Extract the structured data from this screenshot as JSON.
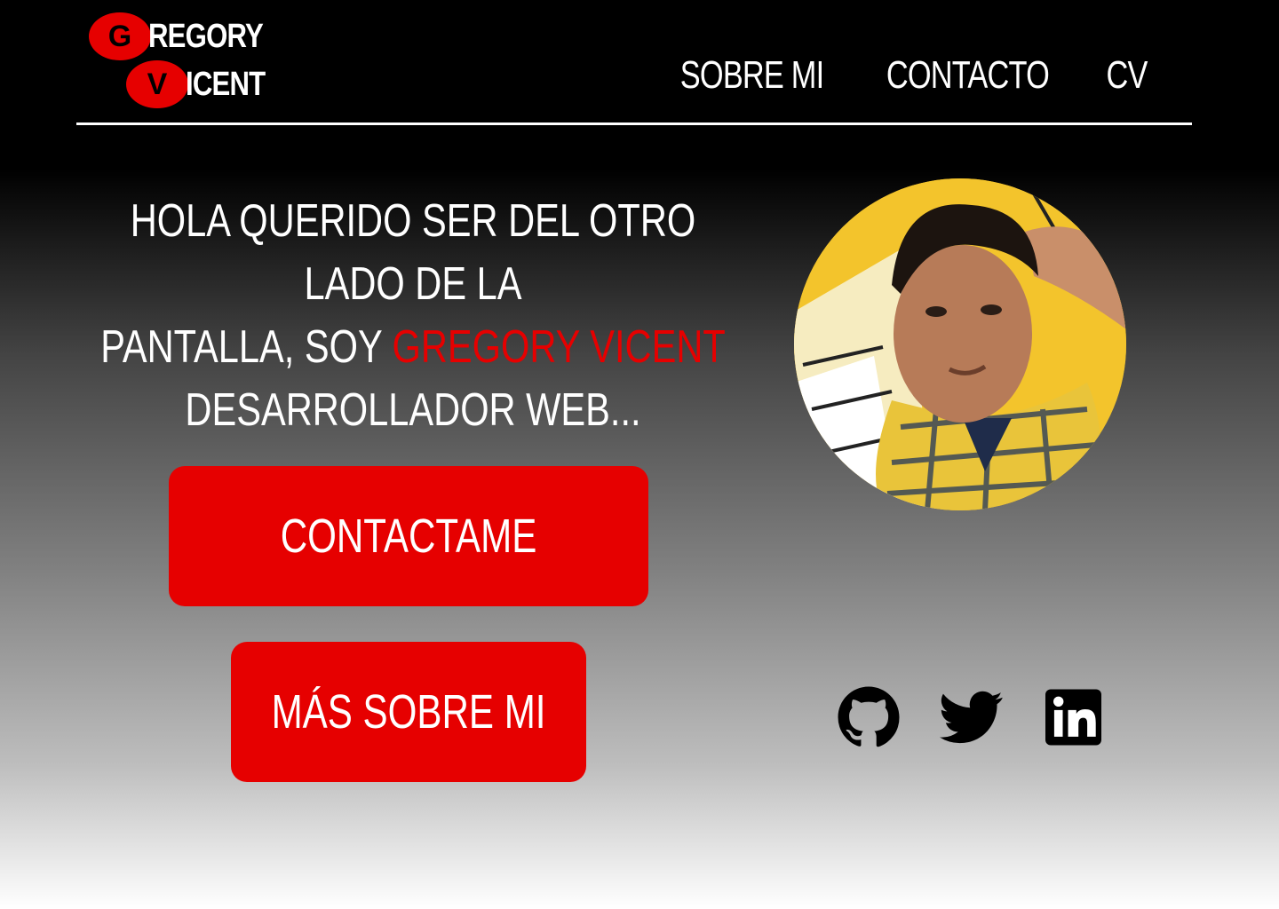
{
  "logo": {
    "first_initial": "G",
    "first_rest": "REGORY",
    "second_initial": "V",
    "second_rest": "ICENT"
  },
  "nav": {
    "items": [
      {
        "label": "SOBRE MI"
      },
      {
        "label": "CONTACTO"
      },
      {
        "label": "CV"
      }
    ]
  },
  "hero": {
    "line1": "HOLA QUERIDO SER DEL OTRO LADO DE LA",
    "line2_prefix": "PANTALLA, SOY ",
    "line2_highlight": "GREGORY VICENT",
    "line3": "DESARROLLADOR WEB..."
  },
  "buttons": {
    "contact_label": "CONTACTAME",
    "more_label": "MÁS SOBRE MI"
  },
  "social": {
    "icons": [
      "github-icon",
      "twitter-icon",
      "linkedin-icon"
    ]
  },
  "colors": {
    "accent": "#e60000",
    "background_top": "#000000",
    "background_bottom": "#ffffff",
    "text": "#ffffff"
  }
}
